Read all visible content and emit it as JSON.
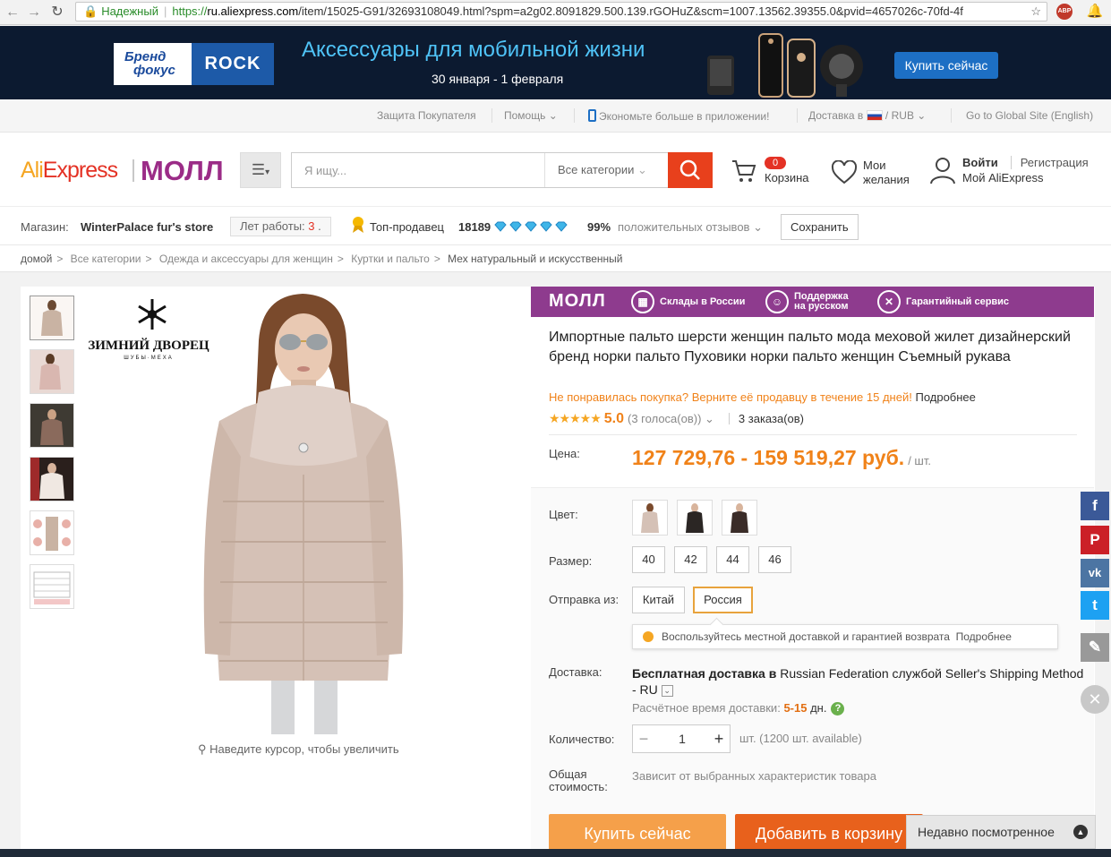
{
  "browser": {
    "secure_label": "Надежный",
    "url_scheme": "https://",
    "url_host": "ru.aliexpress.com",
    "url_path": "/item/15025-G91/32693108049.html?spm=a2g02.8091829.500.139.rGOHuZ&scm=1007.13562.39355.0&pvid=4657026c-70fd-4f",
    "adblock": "ABP"
  },
  "banner": {
    "brand_line1": "Бренд",
    "brand_line2": "фокус",
    "rock_logo": "ROCK",
    "title": "Аксессуары для мобильной жизни",
    "dates": "30 января - 1 февраля",
    "cta": "Купить сейчас"
  },
  "toplinks": {
    "buyer_protection": "Защита Покупателя",
    "help": "Помощь",
    "app": "Экономьте больше в приложении!",
    "delivery_to": "Доставка в",
    "currency": "RUB",
    "global_site": "Go to Global Site (English)"
  },
  "header": {
    "logo_ali": "Ali",
    "logo_express": "Express",
    "logo_mall": "МОЛЛ",
    "search_placeholder": "Я ищу...",
    "all_categories": "Все категории",
    "cart_count": "0",
    "cart_label": "Корзина",
    "wishlist_line1": "Мои",
    "wishlist_line2": "желания",
    "signin": "Войти",
    "register": "Регистрация",
    "my_aliexpress": "Мой AliExpress"
  },
  "store": {
    "label": "Магазин:",
    "name": "WinterPalace fur's store",
    "years_label": "Лет работы:",
    "years_value": "3",
    "top_seller": "Топ-продавец",
    "score": "18189",
    "positive_pct": "99%",
    "positive_label": "положительных отзывов",
    "save": "Сохранить"
  },
  "breadcrumbs": [
    "домой",
    "Все категории",
    "Одежда и аксессуары для женщин",
    "Куртки и пальто",
    "Мех натуральный и искусственный"
  ],
  "gallery": {
    "brand_name": "ЗИМНИЙ ДВОРЕЦ",
    "brand_sub": "ШУБЫ·МЕХА",
    "zoom_hint": "Наведите курсор, чтобы увеличить"
  },
  "mallbar": {
    "mall": "МОЛЛ",
    "warehouses": "Склады в России",
    "support_line1": "Поддержка",
    "support_line2": "на русском",
    "warranty": "Гарантийный сервис"
  },
  "product": {
    "title": "Импортные пальто шерсти женщин пальто мода меховой жилет дизайнерский бренд норки пальто Пуховики норки пальто женщин Съемный рукава",
    "return_text": "Не понравилась покупка? Верните её продавцу в течение 15 дней!",
    "return_more": "Подробнее",
    "stars": "★★★★★",
    "rating": "5.0",
    "votes": "(3 голоса(ов))",
    "orders": "3 заказа(ов)",
    "price_label": "Цена:",
    "price": "127 729,76 - 159 519,27 руб.",
    "price_unit": "/ шт."
  },
  "options": {
    "color_label": "Цвет:",
    "size_label": "Размер:",
    "sizes": [
      "40",
      "42",
      "44",
      "46"
    ],
    "ship_from_label": "Отправка из:",
    "ship_from": [
      "Китай",
      "Россия"
    ],
    "tip": "Воспользуйтесь местной доставкой и гарантией возврата",
    "tip_more": "Подробнее",
    "delivery_label": "Доставка:",
    "delivery_free": "Бесплатная доставка в",
    "delivery_country": "Russian Federation",
    "delivery_via": "службой",
    "delivery_method": "Seller's Shipping Method - RU",
    "delivery_time_label": "Расчётное время доставки:",
    "delivery_time": "5-15",
    "delivery_days": "дн.",
    "qty_label": "Количество:",
    "qty_value": "1",
    "qty_avail": "шт. (1200 шт. available)",
    "total_line1": "Общая",
    "total_line2": "стоимость:",
    "total_value": "Зависит от выбранных характеристик товара",
    "buy_now": "Купить сейчас",
    "add_cart": "Добавить в корзину"
  },
  "recent": "Недавно посмотренное",
  "colors": {
    "accent": "#f08219",
    "mall": "#8e3b8e",
    "search": "#e8401c"
  }
}
